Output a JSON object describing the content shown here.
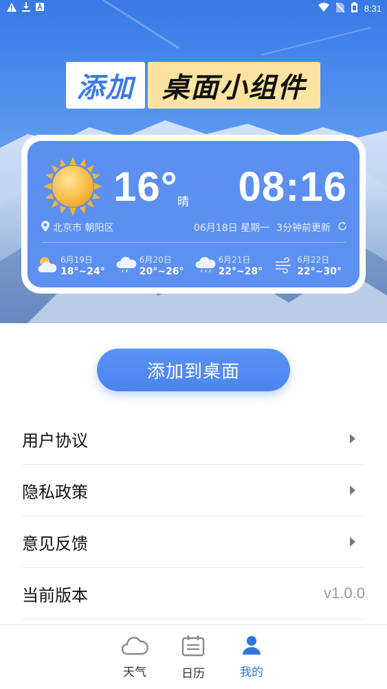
{
  "status_bar": {
    "time": "8:31",
    "left_icons": [
      "warning-icon",
      "download-icon",
      "font-a-icon"
    ],
    "right_icons": [
      "wifi-icon",
      "no-sim-icon",
      "battery-icon"
    ]
  },
  "hero": {
    "title_part1": "添加",
    "title_part2": "桌面小组件",
    "colors": {
      "accent_blue": "#3b7be8",
      "title_yellow": "#fde3a0"
    }
  },
  "widget": {
    "weather_icon": "sun-icon",
    "temperature": "16°",
    "condition": "晴",
    "clock": "08:16",
    "location": "北京市 朝阳区",
    "date_text": "06月18日 星期一",
    "updated_text": "3分钟前更新",
    "forecast": [
      {
        "icon": "partly-cloudy-icon",
        "date": "6月19日",
        "range": "18°~24°"
      },
      {
        "icon": "cloud-rain-icon",
        "date": "6月20日",
        "range": "20°~26°"
      },
      {
        "icon": "cloud-rain-icon",
        "date": "6月21日",
        "range": "22°~28°"
      },
      {
        "icon": "wind-icon",
        "date": "6月22日",
        "range": "22°~30°"
      }
    ]
  },
  "add_button": {
    "label": "添加到桌面"
  },
  "settings": [
    {
      "label": "用户协议",
      "value": ""
    },
    {
      "label": "隐私政策",
      "value": ""
    },
    {
      "label": "意见反馈",
      "value": ""
    },
    {
      "label": "当前版本",
      "value": "v1.0.0"
    }
  ],
  "tabbar": {
    "tabs": [
      {
        "label": "天气",
        "icon": "cloud-icon",
        "active": false
      },
      {
        "label": "日历",
        "icon": "calendar-icon",
        "active": false
      },
      {
        "label": "我的",
        "icon": "user-icon",
        "active": true
      }
    ],
    "active_color": "#2f76e0"
  }
}
